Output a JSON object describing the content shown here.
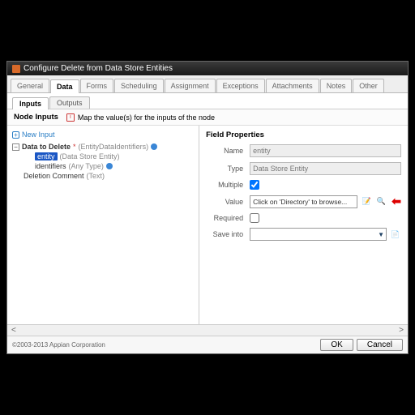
{
  "window": {
    "title": "Configure Delete from Data Store Entities"
  },
  "tabs": {
    "top": [
      "General",
      "Data",
      "Forms",
      "Scheduling",
      "Assignment",
      "Exceptions",
      "Attachments",
      "Notes",
      "Other"
    ],
    "top_active": 1,
    "sub": [
      "Inputs",
      "Outputs"
    ],
    "sub_active": 0
  },
  "note": {
    "heading": "Node Inputs",
    "hint": "Map the value(s) for the inputs of the node"
  },
  "tree": {
    "new_input": "New Input",
    "root": {
      "label": "Data to Delete",
      "star": "*",
      "type": "(EntityDataIdentifiers)"
    },
    "child_selected": {
      "label": "entity",
      "type": "(Data Store Entity)"
    },
    "child2": {
      "label": "identifiers",
      "type": "(Any Type)"
    },
    "sibling": {
      "label": "Deletion Comment",
      "type": "(Text)"
    }
  },
  "props": {
    "heading": "Field Properties",
    "name_label": "Name",
    "name_value": "entity",
    "type_label": "Type",
    "type_value": "Data Store Entity",
    "multiple_label": "Multiple",
    "multiple_checked": true,
    "value_label": "Value",
    "value_text": "Click on 'Directory' to browse...",
    "required_label": "Required",
    "required_checked": false,
    "saveinto_label": "Save into",
    "saveinto_value": ""
  },
  "footer": {
    "copyright": "©2003-2013 Appian Corporation",
    "ok": "OK",
    "cancel": "Cancel"
  }
}
